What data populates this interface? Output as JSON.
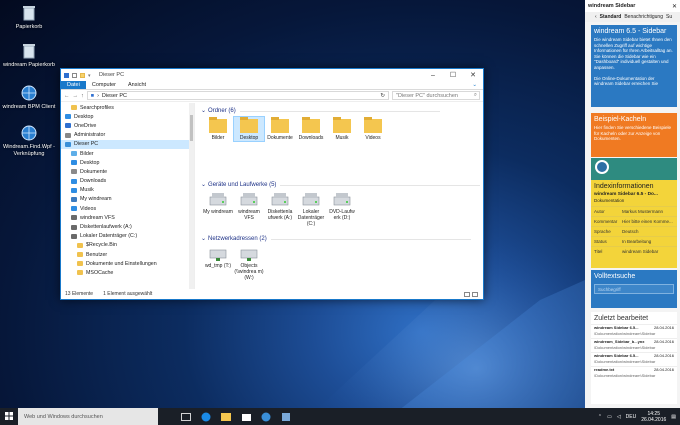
{
  "desktop_icons": [
    {
      "label": "Papierkorb",
      "icon": "recycle-bin-icon"
    },
    {
      "label": "windream Papierkorb",
      "icon": "recycle-bin-icon"
    },
    {
      "label": "windream BPM Client",
      "icon": "globe-icon"
    },
    {
      "label": "Windream.Find.Wpf - Verknüpfung",
      "icon": "globe-icon"
    }
  ],
  "explorer": {
    "title": "Dieser PC",
    "ribbon_tabs": [
      "Datei",
      "Computer",
      "Ansicht"
    ],
    "address": "Dieser PC",
    "search_placeholder": "\"Dieser PC\" durchsuchen",
    "nav_items": [
      {
        "label": "Searchprofiles",
        "color": "#f0c24e",
        "indent": 10
      },
      {
        "label": "Desktop",
        "color": "#2e8de3",
        "indent": 4
      },
      {
        "label": "OneDrive",
        "color": "#2e6fd0",
        "indent": 4
      },
      {
        "label": "Administrator",
        "color": "#888888",
        "indent": 4
      },
      {
        "label": "Dieser PC",
        "color": "#3a8fd8",
        "indent": 4,
        "selected": true
      },
      {
        "label": "Bilder",
        "color": "#5eaee8",
        "indent": 10
      },
      {
        "label": "Desktop",
        "color": "#2e8de3",
        "indent": 10
      },
      {
        "label": "Dokumente",
        "color": "#8a8a8a",
        "indent": 10
      },
      {
        "label": "Downloads",
        "color": "#2e8de3",
        "indent": 10
      },
      {
        "label": "Musik",
        "color": "#2e8de3",
        "indent": 10
      },
      {
        "label": "My windream",
        "color": "#3c7bbf",
        "indent": 10
      },
      {
        "label": "Videos",
        "color": "#2e8de3",
        "indent": 10
      },
      {
        "label": "windream VFS",
        "color": "#6a6a6a",
        "indent": 10
      },
      {
        "label": "Diskettenlaufwerk (A:)",
        "color": "#6a6a6a",
        "indent": 10
      },
      {
        "label": "Lokaler Datenträger (C:)",
        "color": "#6a6a6a",
        "indent": 10
      },
      {
        "label": "$Recycle.Bin",
        "color": "#f0c24e",
        "indent": 16
      },
      {
        "label": "Benutzer",
        "color": "#f0c24e",
        "indent": 16
      },
      {
        "label": "Dokumente und Einstellungen",
        "color": "#f0c24e",
        "indent": 16
      },
      {
        "label": "MSOCache",
        "color": "#f0c24e",
        "indent": 16
      }
    ],
    "sections": {
      "folders": "Ordner (6)",
      "drives": "Geräte und Laufwerke (5)",
      "network": "Netzwerkadressen (2)"
    },
    "folders": [
      "Bilder",
      "Desktop",
      "Dokumente",
      "Downloads",
      "Musik",
      "Videos"
    ],
    "drives": [
      "My windream",
      "windream VFS",
      "Diskettenla ufwerk (A:)",
      "Lokaler Datenträger (C:)",
      "DVD-Laufw erk (D:)"
    ],
    "network": [
      "wd_tmp (T:)",
      "Objects (\\\\windrea m) (W:)"
    ],
    "status_count": "13 Elemente",
    "status_selected": "1 Element ausgewählt"
  },
  "sidebar": {
    "title": "windream Sidebar",
    "tabs": [
      "Standard",
      "Benachrichtigung",
      "Su"
    ],
    "panel1": {
      "title": "windream 6.5 - Sidebar",
      "text": "Die windream Sidebar bietet Ihnen den schnellen Zugriff auf wichtige Informationen für Ihren Arbeitsalltag an. Sie können die Sidebar wie ein \"Dashboard\" individuell gestalten und anpassen.\n\nDie Online-Dokumentation der windream Sidebar erreichen Sie",
      "color": "#2b79c2"
    },
    "panel2": {
      "title": "Beispiel-Kacheln",
      "text": "Hier finden Sie verschiedene Beispiele für Kacheln oder zur Anzeige von Dokumenten.",
      "color": "#f07a22"
    },
    "panel3": {
      "title": "Indexinformationen",
      "doc": "windream Sidebar 6.5 - Do...",
      "doc_type": "Dokumentation",
      "color": "#f3d43a",
      "rows": [
        [
          "Autor",
          "Markus Mustermann"
        ],
        [
          "Kommentar",
          "Hier bitte einen Komme..."
        ],
        [
          "Sprache",
          "Deutsch"
        ],
        [
          "Status",
          "In Bearbeitung"
        ],
        [
          "Titel",
          "windream Sidebar"
        ]
      ]
    },
    "panel4": {
      "title": "Volltextsuche",
      "placeholder": "Suchbegriff",
      "color": "#2b79c2"
    },
    "panel5": {
      "title": "Zuletzt bearbeitet",
      "items": [
        [
          "windream Sidebar 6.5...",
          "28.04.2016",
          "\\Dokumentation\\windream\\Sidebar"
        ],
        [
          "windream_Sidebar_b...ynx",
          "28.04.2016",
          "\\Dokumentation\\windream\\Sidebar"
        ],
        [
          "windream Sidebar 6.5...",
          "28.04.2016",
          "\\Dokumentation\\windream\\Sidebar"
        ],
        [
          "readme.txt",
          "28.04.2016",
          "\\Dokumentation\\windream\\Sidebar"
        ]
      ]
    }
  },
  "taskbar": {
    "search": "Web und Windows durchsuchen",
    "lang": "DEU",
    "time": "14:25",
    "date": "26.04.2016"
  }
}
